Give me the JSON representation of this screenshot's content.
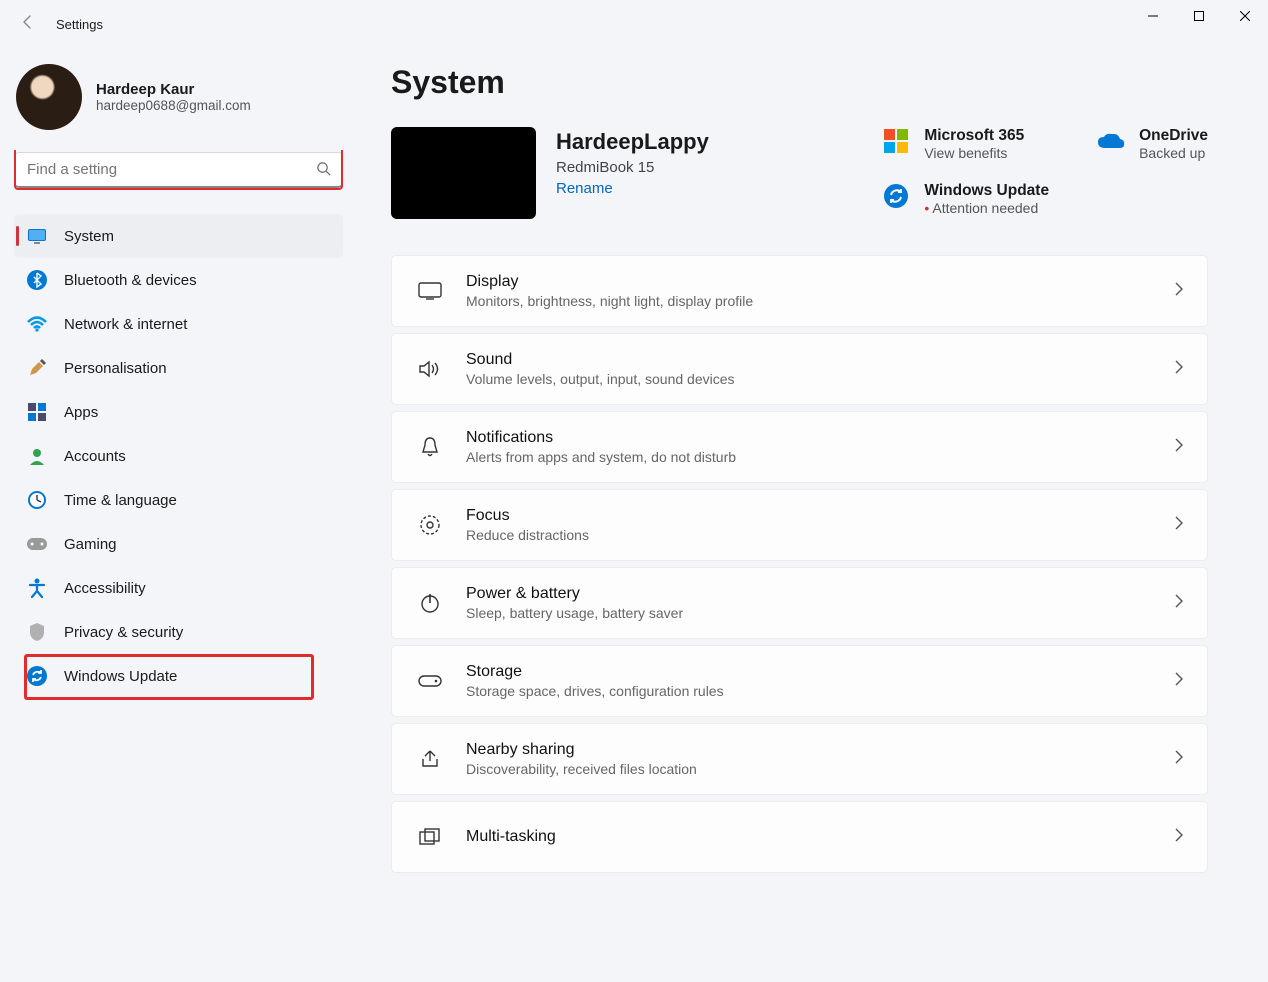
{
  "app": {
    "title": "Settings"
  },
  "user": {
    "name": "Hardeep Kaur",
    "email": "hardeep0688@gmail.com"
  },
  "search": {
    "placeholder": "Find a setting"
  },
  "sidebar": {
    "items": [
      {
        "label": "System"
      },
      {
        "label": "Bluetooth & devices"
      },
      {
        "label": "Network & internet"
      },
      {
        "label": "Personalisation"
      },
      {
        "label": "Apps"
      },
      {
        "label": "Accounts"
      },
      {
        "label": "Time & language"
      },
      {
        "label": "Gaming"
      },
      {
        "label": "Accessibility"
      },
      {
        "label": "Privacy & security"
      },
      {
        "label": "Windows Update"
      }
    ],
    "active_index": 0,
    "highlight_index": 10
  },
  "page": {
    "heading": "System",
    "device": {
      "name": "HardeepLappy",
      "model": "RedmiBook 15",
      "rename": "Rename"
    },
    "status": [
      {
        "title": "Microsoft 365",
        "sub": "View benefits"
      },
      {
        "title": "OneDrive",
        "sub": "Backed up"
      },
      {
        "title": "Windows Update",
        "sub": "Attention needed",
        "attn": true
      }
    ],
    "rows": [
      {
        "title": "Display",
        "sub": "Monitors, brightness, night light, display profile"
      },
      {
        "title": "Sound",
        "sub": "Volume levels, output, input, sound devices"
      },
      {
        "title": "Notifications",
        "sub": "Alerts from apps and system, do not disturb"
      },
      {
        "title": "Focus",
        "sub": "Reduce distractions"
      },
      {
        "title": "Power & battery",
        "sub": "Sleep, battery usage, battery saver"
      },
      {
        "title": "Storage",
        "sub": "Storage space, drives, configuration rules"
      },
      {
        "title": "Nearby sharing",
        "sub": "Discoverability, received files location"
      },
      {
        "title": "Multi-tasking",
        "sub": ""
      }
    ]
  }
}
